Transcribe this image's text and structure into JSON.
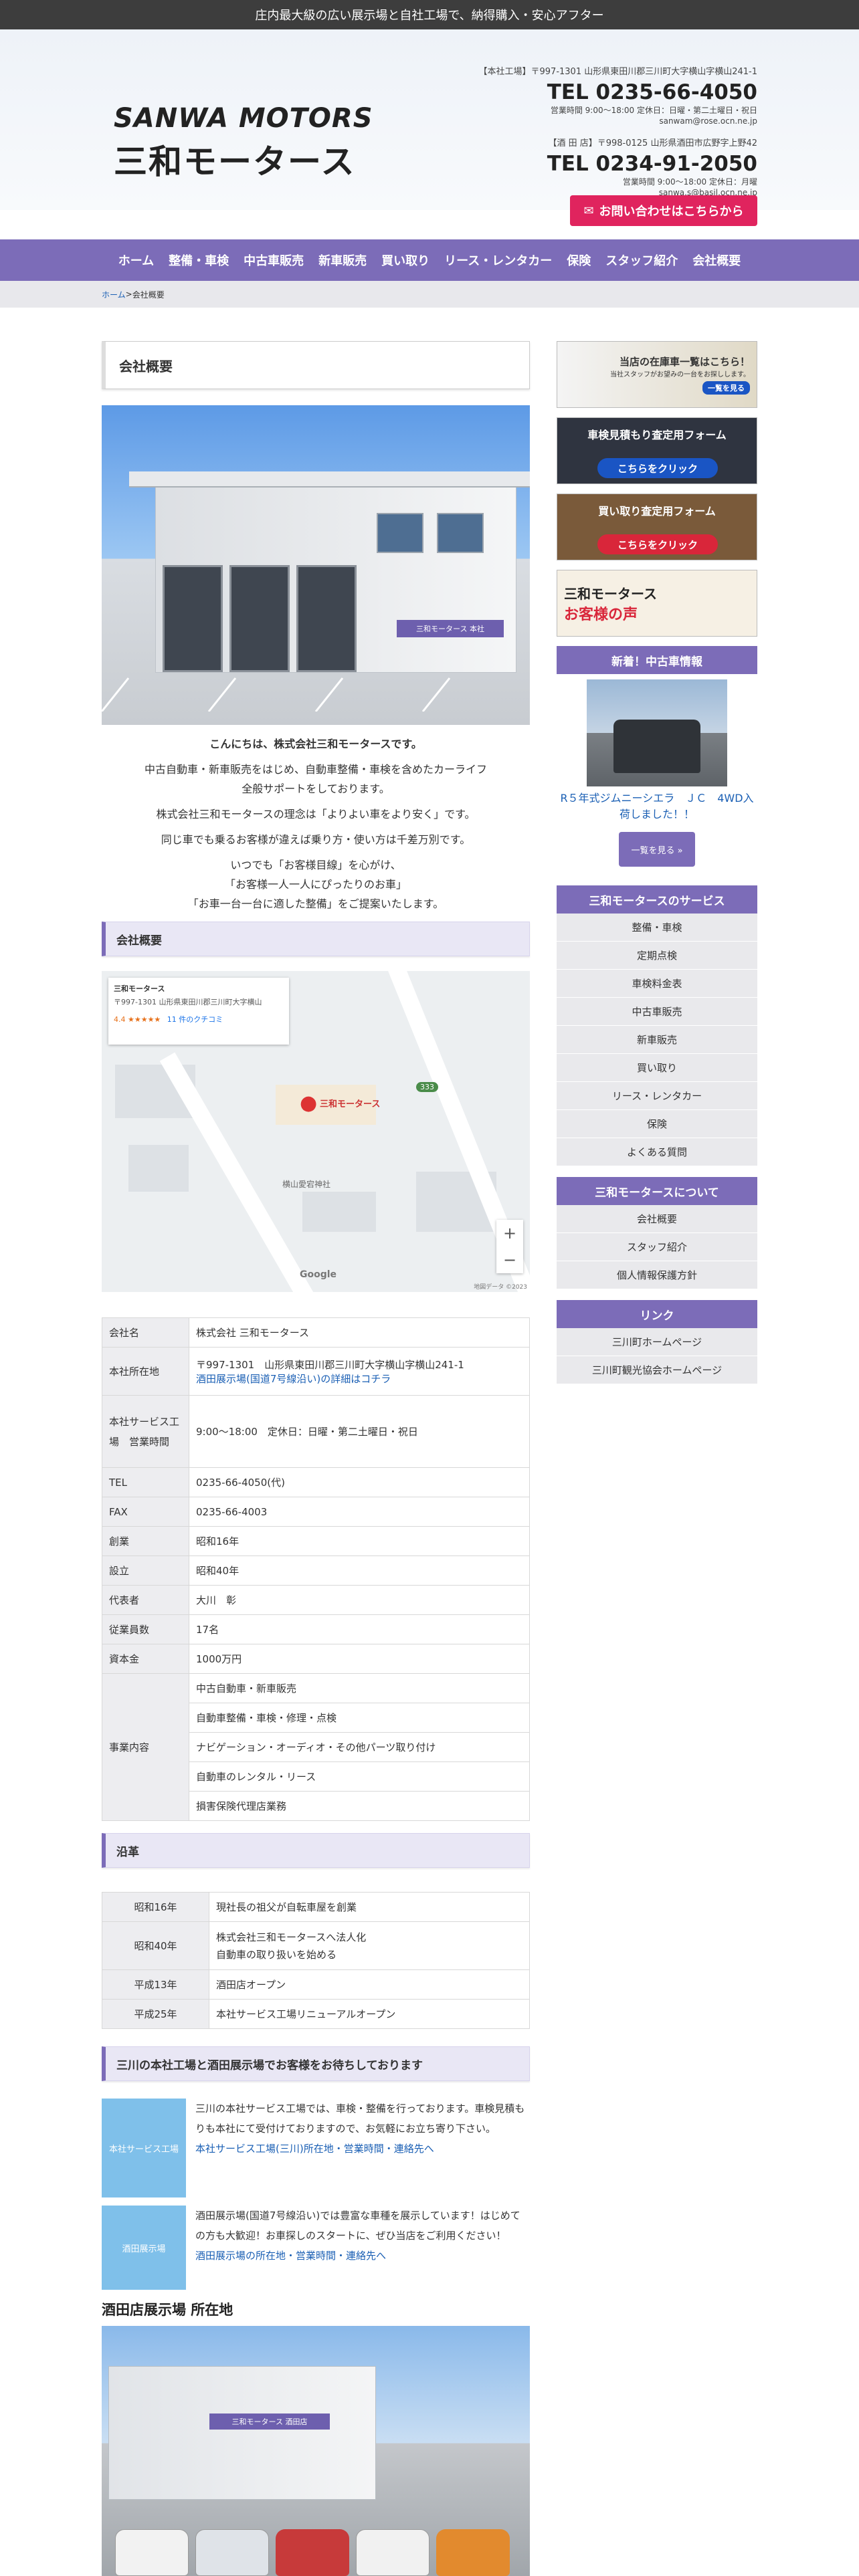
{
  "topbar": {
    "text": "庄内最大級の広い展示場と自社工場で、納得購入・安心アフター"
  },
  "logo": {
    "en": "SANWA MOTORS",
    "jp": "三和モータース"
  },
  "header_info": {
    "main_addr": "【本社工場】〒997-1301 山形県東田川郡三川町大字横山字横山241-1",
    "main_tel": "TEL 0235-66-4050",
    "main_hours": "営業時間 9:00～18:00 定休日：日曜・第二土曜日・祝日",
    "main_mail": "sanwam@rose.ocn.ne.jp",
    "sakata_addr": "【酒 田 店】〒998-0125 山形県酒田市広野字上野42",
    "sakata_tel": "TEL 0234-91-2050",
    "sakata_hours": "営業時間 9:00～18:00 定休日：月曜",
    "sakata_mail": "sanwa.s@basil.ocn.ne.jp"
  },
  "cta": {
    "label": "お問い合わせはこちらから"
  },
  "nav": [
    "ホーム",
    "整備・車検",
    "中古車販売",
    "新車販売",
    "買い取り",
    "リース・レンタカー",
    "保険",
    "スタッフ紹介",
    "会社概要"
  ],
  "breadcrumb": {
    "home": "ホーム",
    "sep": " > ",
    "current": "会社概要"
  },
  "main": {
    "page_title": "会社概要",
    "building_sign": "三和モータース 本社",
    "greeting": {
      "headline": "こんにちは、株式会社三和モータースです。",
      "p1": "中古自動車・新車販売をはじめ、自動車整備・車検を含めたカーライフ全般サポートをしております。",
      "p2": "株式会社三和モータースの理念は「よりよい車をより安く」です。",
      "p3": "同じ車でも乗るお客様が違えば乗り方・使い方は千差万別です。",
      "p4a": "いつでも「お客様目線」を心がけ、",
      "p4b": "「お客様一人一人にぴったりのお車」",
      "p4c": "「お車一台一台に適した整備」をご提案いたします。"
    },
    "section_company": "会社概要",
    "map": {
      "card_title": "三和モータース",
      "card_addr": "〒997-1301 山形県東田川郡三川町大字横山",
      "rating": "4.4 ★★★★★",
      "reviews": "11 件のクチコミ",
      "pin_label": "三和モータース",
      "shrine": "横山愛宕神社",
      "route": "333",
      "google": "Google",
      "attribution": "地図データ ©2023"
    },
    "company_table": {
      "name_label": "会社名",
      "name": "株式会社 三和モータース",
      "addr_label": "本社所在地",
      "addr": "〒997-1301　山形県東田川郡三川町大字横山字横山241-1",
      "addr_link": "酒田展示場(国道7号線沿い)の詳細はコチラ",
      "hours_label": "本社サービス工場　営業時間",
      "hours": "9:00～18:00　定休日：日曜・第二土曜日・祝日",
      "tel_label": "TEL",
      "tel": "0235-66-4050(代)",
      "fax_label": "FAX",
      "fax": "0235-66-4003",
      "founded_label": "創業",
      "founded": "昭和16年",
      "est_label": "設立",
      "est": "昭和40年",
      "rep_label": "代表者",
      "rep": "大川　彰",
      "staff_label": "従業員数",
      "staff": "17名",
      "capital_label": "資本金",
      "capital": "1000万円",
      "biz_label": "事業内容",
      "biz": [
        "中古自動車・新車販売",
        "自動車整備・車検・修理・点検",
        "ナビゲーション・オーディオ・その他パーツ取り付け",
        "自動車のレンタル・リース",
        "損害保険代理店業務"
      ]
    },
    "section_history": "沿革",
    "history": [
      {
        "year": "昭和16年",
        "text": "現社長の祖父が自転車屋を創業",
        "text2": ""
      },
      {
        "year": "昭和40年",
        "text": "株式会社三和モータースへ法人化",
        "text2": "自動車の取り扱いを始める"
      },
      {
        "year": "平成13年",
        "text": "酒田店オープン",
        "text2": ""
      },
      {
        "year": "平成25年",
        "text": "本社サービス工場リニューアルオープン",
        "text2": ""
      }
    ],
    "section_welcome": "三川の本社工場と酒田展示場でお客様をお待ちしております",
    "promo1": {
      "thumb": "本社サービス工場",
      "text": "三川の本社サービス工場では、車検・整備を行っております。車検見積もりも本社にて受付けておりますので、お気軽にお立ち寄り下さい。",
      "link": "本社サービス工場(三川)所在地・営業時間・連絡先へ"
    },
    "promo2": {
      "thumb": "酒田展示場",
      "text": "酒田展示場(国道7号線沿い)では豊富な車種を展示しています！はじめての方も大歓迎！お車探しのスタートに、ぜひ当店をご利用ください！",
      "link": "酒田展示場の所在地・営業時間・連絡先へ"
    },
    "sakata_heading": "酒田店展示場 所在地",
    "sakata_sign": "三和モータース 酒田店"
  },
  "side": {
    "banner1": "当店の在庫車一覧はこちら！",
    "banner1_sub": "当社スタッフがお望みの一台をお探しします。",
    "banner1_btn": "一覧を見る",
    "banner2": "車検見積もり査定用フォーム",
    "banner2_btn": "こちらをクリック",
    "banner3": "買い取り査定用フォーム",
    "banner3_btn": "こちらをクリック",
    "banner4a": "三和モータース",
    "banner4b": "お客様の声",
    "new_head": "新着！中古車情報",
    "new_caption": "R５年式ジムニーシエラ　ＪＣ　4WD入荷しました！！",
    "more_btn": "一覧を見る »",
    "services_head": "三和モータースのサービス",
    "services": [
      "整備・車検",
      "定期点検",
      "車検料金表",
      "中古車販売",
      "新車販売",
      "買い取り",
      "リース・レンタカー",
      "保険",
      "よくある質問"
    ],
    "about_head": "三和モータースについて",
    "about": [
      "会社概要",
      "スタッフ紹介",
      "個人情報保護方針"
    ],
    "links_head": "リンク",
    "links": [
      "三川町ホームページ",
      "三川町観光協会ホームページ"
    ]
  },
  "colors": {
    "accent": "#7c6cb8",
    "cta": "#e0245e",
    "link": "#1a5fb4"
  }
}
